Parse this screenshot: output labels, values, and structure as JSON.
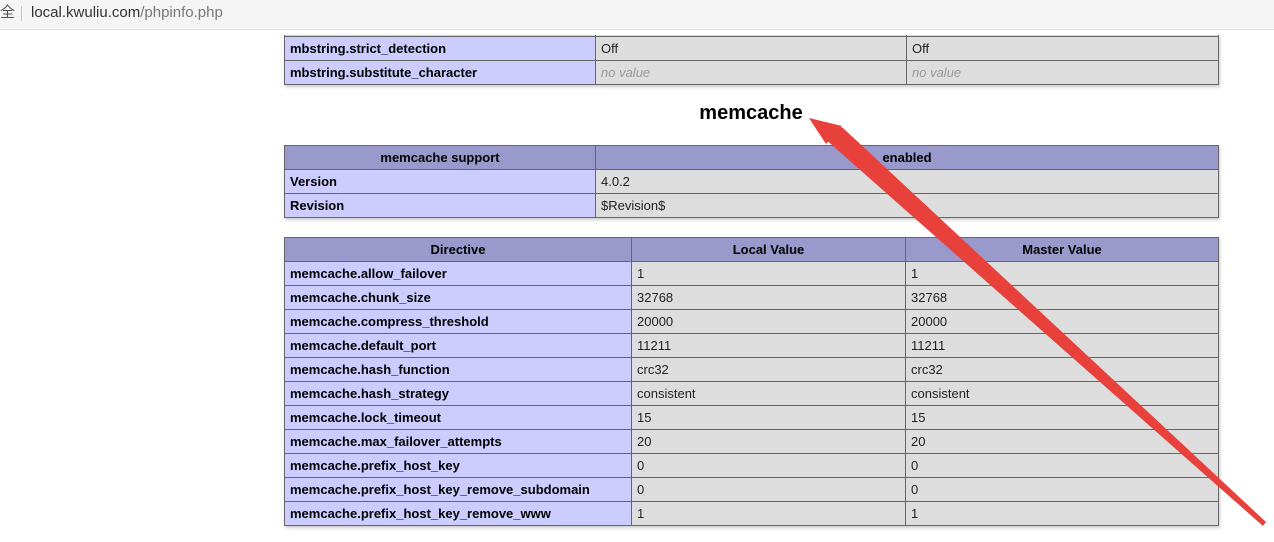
{
  "address_bar": {
    "secure_glyph": "全",
    "url_host": "local.kwuliu.com",
    "url_path": "/phpinfo.php"
  },
  "mbstring_rows": [
    {
      "directive": "mbstring.strict_detection",
      "local": "Off",
      "master": "Off",
      "no_value": false
    },
    {
      "directive": "mbstring.substitute_character",
      "local": "no value",
      "master": "no value",
      "no_value": true
    }
  ],
  "memcache": {
    "title": "memcache",
    "support_table": {
      "header": {
        "left": "memcache support",
        "right": "enabled"
      },
      "rows": [
        {
          "label": "Version",
          "value": "4.0.2"
        },
        {
          "label": "Revision",
          "value": "$Revision$"
        }
      ]
    },
    "directives": {
      "headers": {
        "directive": "Directive",
        "local": "Local Value",
        "master": "Master Value"
      },
      "rows": [
        {
          "directive": "memcache.allow_failover",
          "local": "1",
          "master": "1"
        },
        {
          "directive": "memcache.chunk_size",
          "local": "32768",
          "master": "32768"
        },
        {
          "directive": "memcache.compress_threshold",
          "local": "20000",
          "master": "20000"
        },
        {
          "directive": "memcache.default_port",
          "local": "11211",
          "master": "11211"
        },
        {
          "directive": "memcache.hash_function",
          "local": "crc32",
          "master": "crc32"
        },
        {
          "directive": "memcache.hash_strategy",
          "local": "consistent",
          "master": "consistent"
        },
        {
          "directive": "memcache.lock_timeout",
          "local": "15",
          "master": "15"
        },
        {
          "directive": "memcache.max_failover_attempts",
          "local": "20",
          "master": "20"
        },
        {
          "directive": "memcache.prefix_host_key",
          "local": "0",
          "master": "0"
        },
        {
          "directive": "memcache.prefix_host_key_remove_subdomain",
          "local": "0",
          "master": "0"
        },
        {
          "directive": "memcache.prefix_host_key_remove_www",
          "local": "1",
          "master": "1"
        }
      ]
    }
  },
  "colors": {
    "header_bg": "#9999cc",
    "label_bg": "#ccccff",
    "value_bg": "#dddddd",
    "annotation_arrow": "#e8403a"
  }
}
